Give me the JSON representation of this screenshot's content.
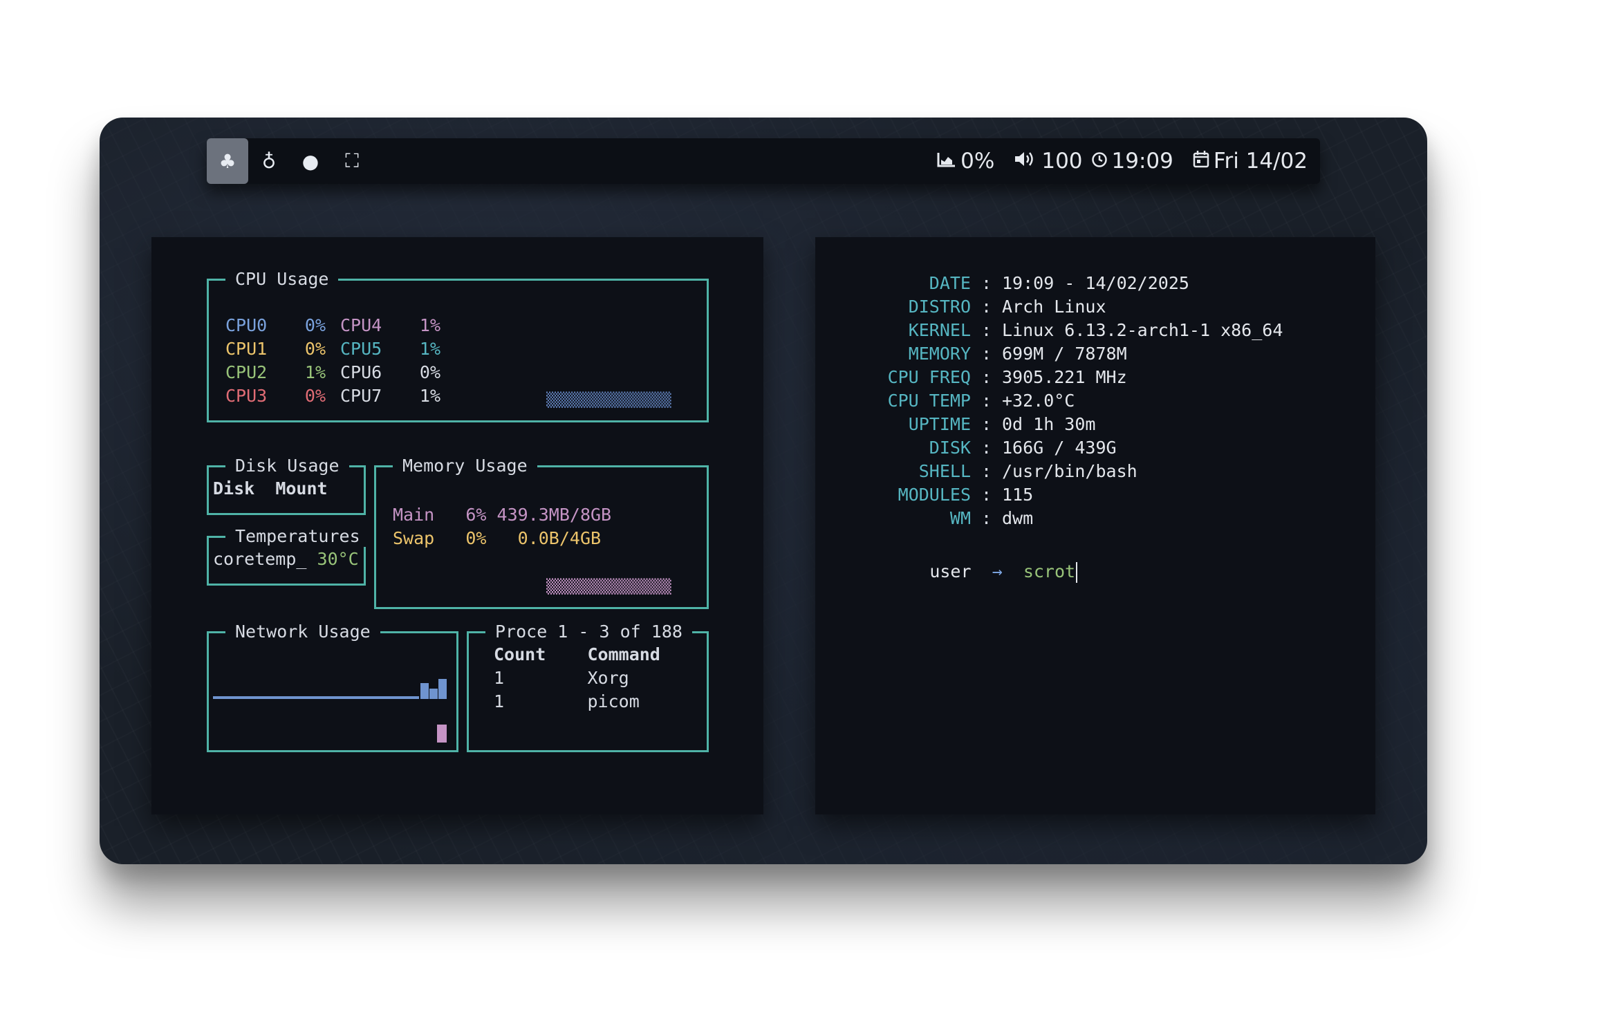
{
  "bar": {
    "tags": [
      {
        "icon": "cherries-icon",
        "glyph": "♣",
        "active": true
      },
      {
        "icon": "pineapple-icon",
        "glyph": "♁",
        "active": false
      },
      {
        "icon": "apple-icon",
        "glyph": "●",
        "active": false
      },
      {
        "icon": "fullscreen-icon",
        "glyph": "⛶",
        "active": false
      }
    ],
    "cpu_icon": "chart-icon",
    "cpu_value": "0%",
    "volume_icon": "speaker-icon",
    "volume_value": "100",
    "clock_icon": "clock-icon",
    "clock_value": "19:09",
    "calendar_icon": "calendar-icon",
    "date_value": "Fri 14/02"
  },
  "btop": {
    "cpu_box": {
      "title": "CPU Usage",
      "cores": [
        {
          "name": "CPU0",
          "value": "0%",
          "color": "#7aa2dd"
        },
        {
          "name": "CPU1",
          "value": "0%",
          "color": "#ecc46b"
        },
        {
          "name": "CPU2",
          "value": "1%",
          "color": "#98c379"
        },
        {
          "name": "CPU3",
          "value": "0%",
          "color": "#e06c75"
        },
        {
          "name": "CPU4",
          "value": "1%",
          "color": "#c594c5"
        },
        {
          "name": "CPU5",
          "value": "1%",
          "color": "#56b6c2"
        },
        {
          "name": "CPU6",
          "value": "0%",
          "color": "#d7dbe3"
        },
        {
          "name": "CPU7",
          "value": "1%",
          "color": "#d7dbe3"
        }
      ]
    },
    "disk_box": {
      "title": "Disk Usage",
      "col_disk": "Disk",
      "col_mount": "Mount"
    },
    "temp_box": {
      "title": "Temperatures",
      "sensor": "coretemp_",
      "value": "30°C"
    },
    "mem_box": {
      "title": "Memory Usage",
      "main_label": "Main",
      "main_pct": "6%",
      "main_amount": "439.3MB/8GB",
      "swap_label": "Swap",
      "swap_pct": "0%",
      "swap_amount": "0.0B/4GB"
    },
    "net_box": {
      "title": "Network Usage",
      "download_level": 0.35,
      "upload_level": 0.4
    },
    "proc_box": {
      "title": "Proce 1 - 3 of 188",
      "col_count": "Count",
      "col_command": "Command",
      "rows": [
        {
          "count": "1",
          "command": "Xorg"
        },
        {
          "count": "1",
          "command": "picom"
        }
      ]
    }
  },
  "terminal": {
    "info": [
      {
        "key": "DATE",
        "value": "19:09 - 14/02/2025"
      },
      {
        "key": "DISTRO",
        "value": "Arch Linux"
      },
      {
        "key": "KERNEL",
        "value": "Linux 6.13.2-arch1-1 x86_64"
      },
      {
        "key": "MEMORY",
        "value": "699M / 7878M"
      },
      {
        "key": "CPU FREQ",
        "value": "3905.221 MHz"
      },
      {
        "key": "CPU TEMP",
        "value": "+32.0°C"
      },
      {
        "key": "UPTIME",
        "value": "0d 1h 30m"
      },
      {
        "key": "DISK",
        "value": "166G / 439G"
      },
      {
        "key": "SHELL",
        "value": "/usr/bin/bash"
      },
      {
        "key": "MODULES",
        "value": "115"
      },
      {
        "key": "WM",
        "value": "dwm"
      }
    ],
    "separator": ":",
    "prompt_user": "user",
    "prompt_arrow": "→",
    "command": "scrot"
  }
}
